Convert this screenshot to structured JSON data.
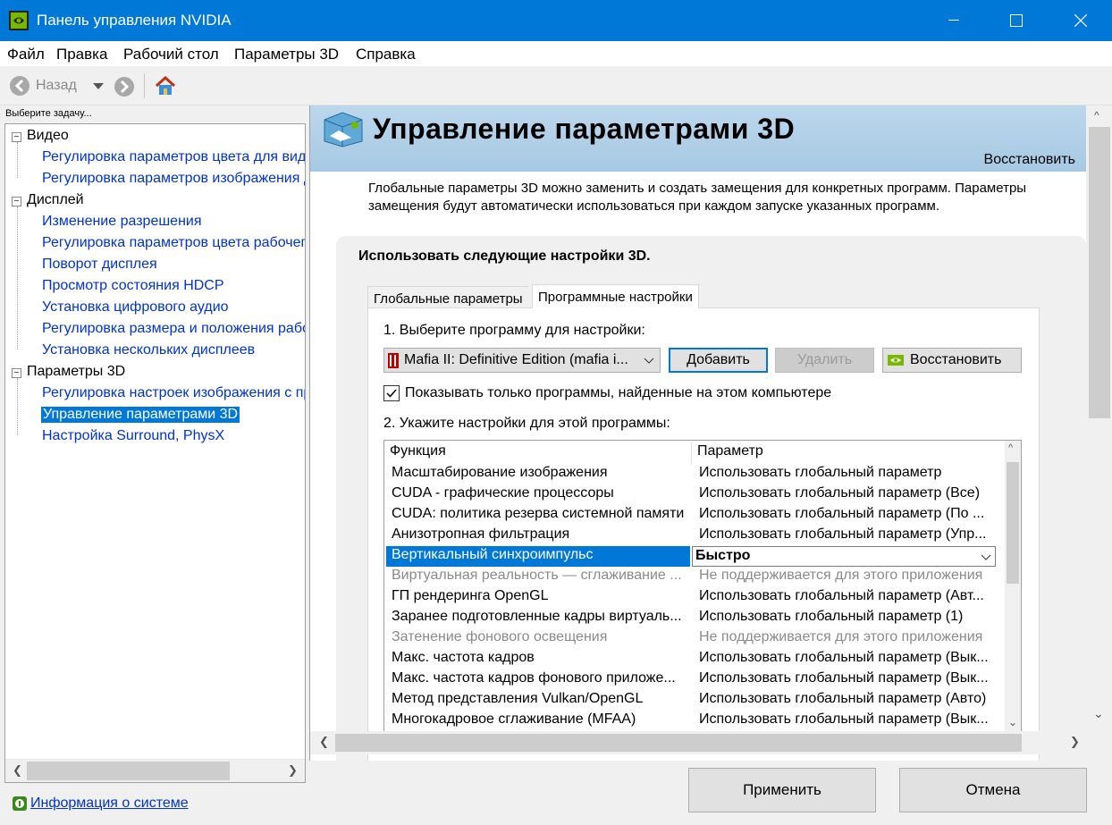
{
  "window": {
    "title": "Панель управления NVIDIA"
  },
  "menu": [
    "Файл",
    "Правка",
    "Рабочий стол",
    "Параметры 3D",
    "Справка"
  ],
  "toolbar": {
    "back_label": "Назад"
  },
  "left": {
    "hint": "Выберите задачу...",
    "tree": [
      {
        "type": "cat",
        "label": "Видео"
      },
      {
        "type": "item",
        "label": "Регулировка параметров цвета для видео"
      },
      {
        "type": "item",
        "label": "Регулировка параметров изображения для видео"
      },
      {
        "type": "cat",
        "label": "Дисплей"
      },
      {
        "type": "item",
        "label": "Изменение разрешения"
      },
      {
        "type": "item",
        "label": "Регулировка параметров цвета рабочего стола"
      },
      {
        "type": "item",
        "label": "Поворот дисплея"
      },
      {
        "type": "item",
        "label": "Просмотр состояния HDCP"
      },
      {
        "type": "item",
        "label": "Установка цифрового аудио"
      },
      {
        "type": "item",
        "label": "Регулировка размера и положения рабочего стола"
      },
      {
        "type": "item",
        "label": "Установка нескольких дисплеев"
      },
      {
        "type": "cat",
        "label": "Параметры 3D"
      },
      {
        "type": "item",
        "label": "Регулировка настроек изображения с просмотром"
      },
      {
        "type": "item",
        "label": "Управление параметрами 3D",
        "selected": true
      },
      {
        "type": "item",
        "label": "Настройка Surround, PhysX"
      }
    ],
    "sysinfo": "Информация о системе"
  },
  "page": {
    "title": "Управление параметрами 3D",
    "restore": "Восстановить",
    "description_1": "Глобальные параметры 3D можно заменить и создать замещения для конкретных программ. Параметры",
    "description_2": "замещения будут автоматически использоваться при каждом запуске указанных программ.",
    "panel_heading": "Использовать следующие настройки 3D.",
    "tabs": [
      "Глобальные параметры",
      "Программные настройки"
    ],
    "step1": "1. Выберите программу для настройки:",
    "program": "Mafia II: Definitive Edition (mafia i...",
    "add": "Добавить",
    "remove": "Удалить",
    "restore_btn": "Восстановить",
    "checkbox_label": "Показывать только программы, найденные на этом компьютере",
    "step2": "2. Укажите настройки для этой программы:",
    "grid_headers": [
      "Функция",
      "Параметр"
    ],
    "rows": [
      {
        "f": "Масштабирование изображения",
        "p": "Использовать глобальный параметр"
      },
      {
        "f": "CUDA - графические процессоры",
        "p": "Использовать глобальный параметр (Все)"
      },
      {
        "f": "CUDA: политика резерва системной памяти",
        "p": "Использовать глобальный параметр (По ..."
      },
      {
        "f": "Анизотропная фильтрация",
        "p": "Использовать глобальный параметр (Упр..."
      },
      {
        "f": "Вертикальный синхроимпульс",
        "p": "Быстро",
        "selected": true
      },
      {
        "f": "Виртуальная реальность — сглаживание ...",
        "p": "Не поддерживается для этого приложения",
        "disabled": true
      },
      {
        "f": "ГП рендеринга OpenGL",
        "p": "Использовать глобальный параметр (Авт..."
      },
      {
        "f": "Заранее подготовленные кадры виртуаль...",
        "p": "Использовать глобальный параметр (1)"
      },
      {
        "f": "Затенение фонового освещения",
        "p": "Не поддерживается для этого приложения",
        "disabled": true
      },
      {
        "f": "Макс. частота кадров",
        "p": "Использовать глобальный параметр (Вык..."
      },
      {
        "f": "Макс. частота кадров фонового приложе...",
        "p": "Использовать глобальный параметр (Вык..."
      },
      {
        "f": "Метод представления Vulkan/OpenGL",
        "p": "Использовать глобальный параметр (Авто)"
      },
      {
        "f": "Многокадровое сглаживание (MFAA)",
        "p": "Использовать глобальный параметр (Вык..."
      }
    ]
  },
  "footer": {
    "apply": "Применить",
    "cancel": "Отмена"
  },
  "colors": {
    "accent": "#0078d7",
    "link": "#0033cc",
    "banner": "#a6c9e3",
    "nvidia_green": "#76b900"
  }
}
